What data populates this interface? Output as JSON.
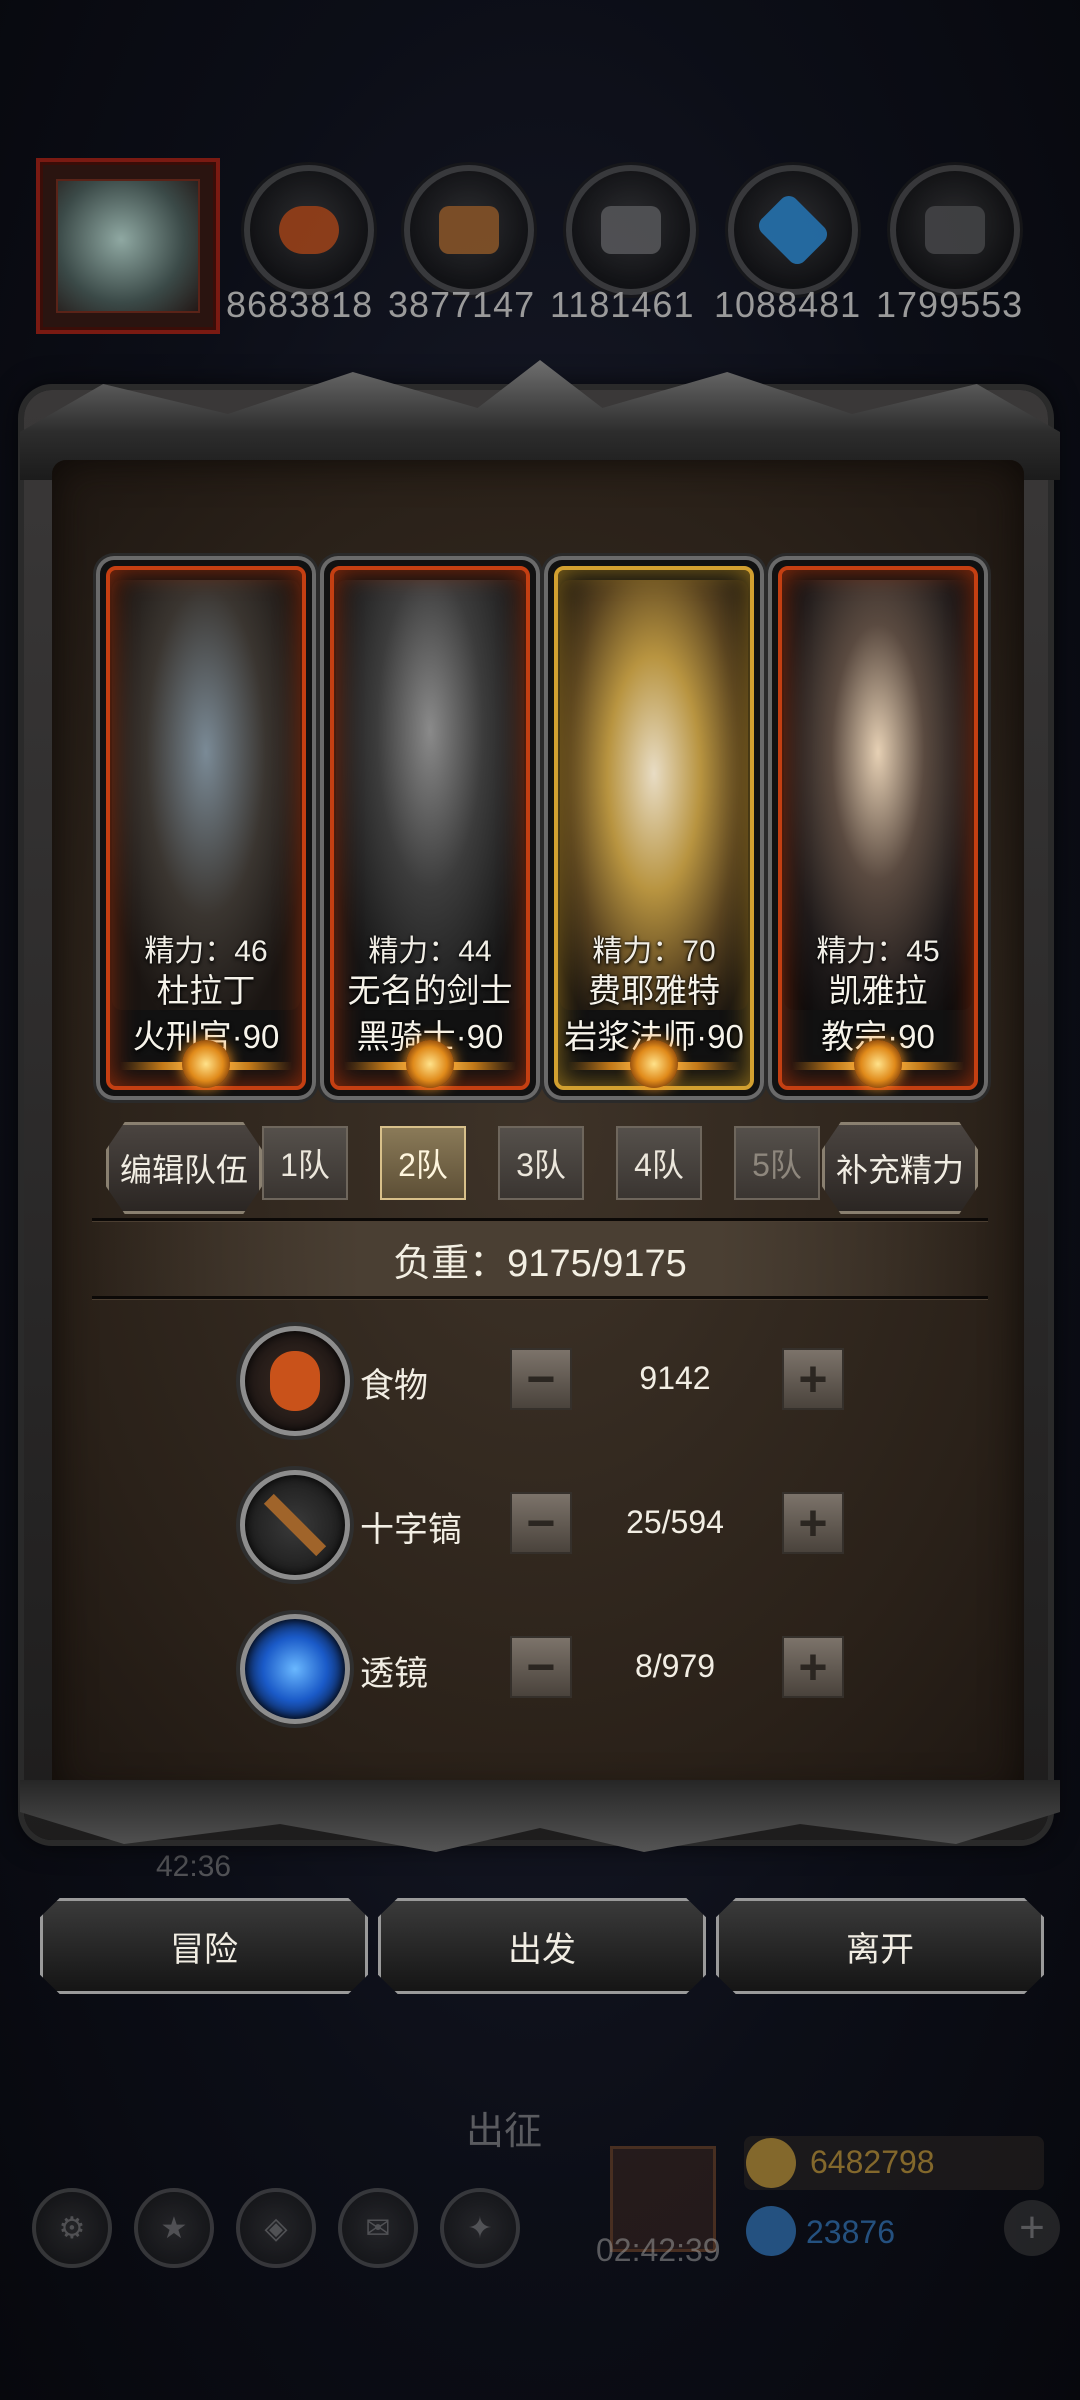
{
  "resources": [
    {
      "icon": "food-icon",
      "value": "8683818",
      "color": "#c1501a"
    },
    {
      "icon": "wood-icon",
      "value": "3877147",
      "color": "#a8672c"
    },
    {
      "icon": "iron-icon",
      "value": "1181461",
      "color": "#6a6a6a"
    },
    {
      "icon": "crystal-icon",
      "value": "1088481",
      "color": "#2f8fd8"
    },
    {
      "icon": "stone-icon",
      "value": "1799553",
      "color": "#555555"
    }
  ],
  "heroes": [
    {
      "stamina": "精力：46",
      "name": "杜拉丁",
      "class": "火刑官·90"
    },
    {
      "stamina": "精力：44",
      "name": "无名的剑士",
      "class": "黑骑士·90"
    },
    {
      "stamina": "精力：70",
      "name": "费耶雅特",
      "class": "岩浆法师·90"
    },
    {
      "stamina": "精力：45",
      "name": "凯雅拉",
      "class": "教宗·90"
    }
  ],
  "team_bar": {
    "edit_label": "编辑队伍",
    "tabs": [
      "1队",
      "2队",
      "3队",
      "4队",
      "5队"
    ],
    "active_tab": "2队",
    "refill_label": "补充精力"
  },
  "weight": "负重：9175/9175",
  "supplies": [
    {
      "icon": "food-icon",
      "label": "食物",
      "value": "9142"
    },
    {
      "icon": "pickaxe-icon",
      "label": "十字镐",
      "value": "25/594"
    },
    {
      "icon": "lens-icon",
      "label": "透镜",
      "value": "8/979"
    }
  ],
  "stepper": {
    "minus": "−",
    "plus": "+"
  },
  "actions": {
    "adventure": "冒险",
    "depart": "出发",
    "leave": "离开"
  },
  "background": {
    "timer_left": "42:36",
    "expedition_label": "出征",
    "countdown": "02:42:39",
    "gold": "6482798",
    "gems": "23876"
  }
}
